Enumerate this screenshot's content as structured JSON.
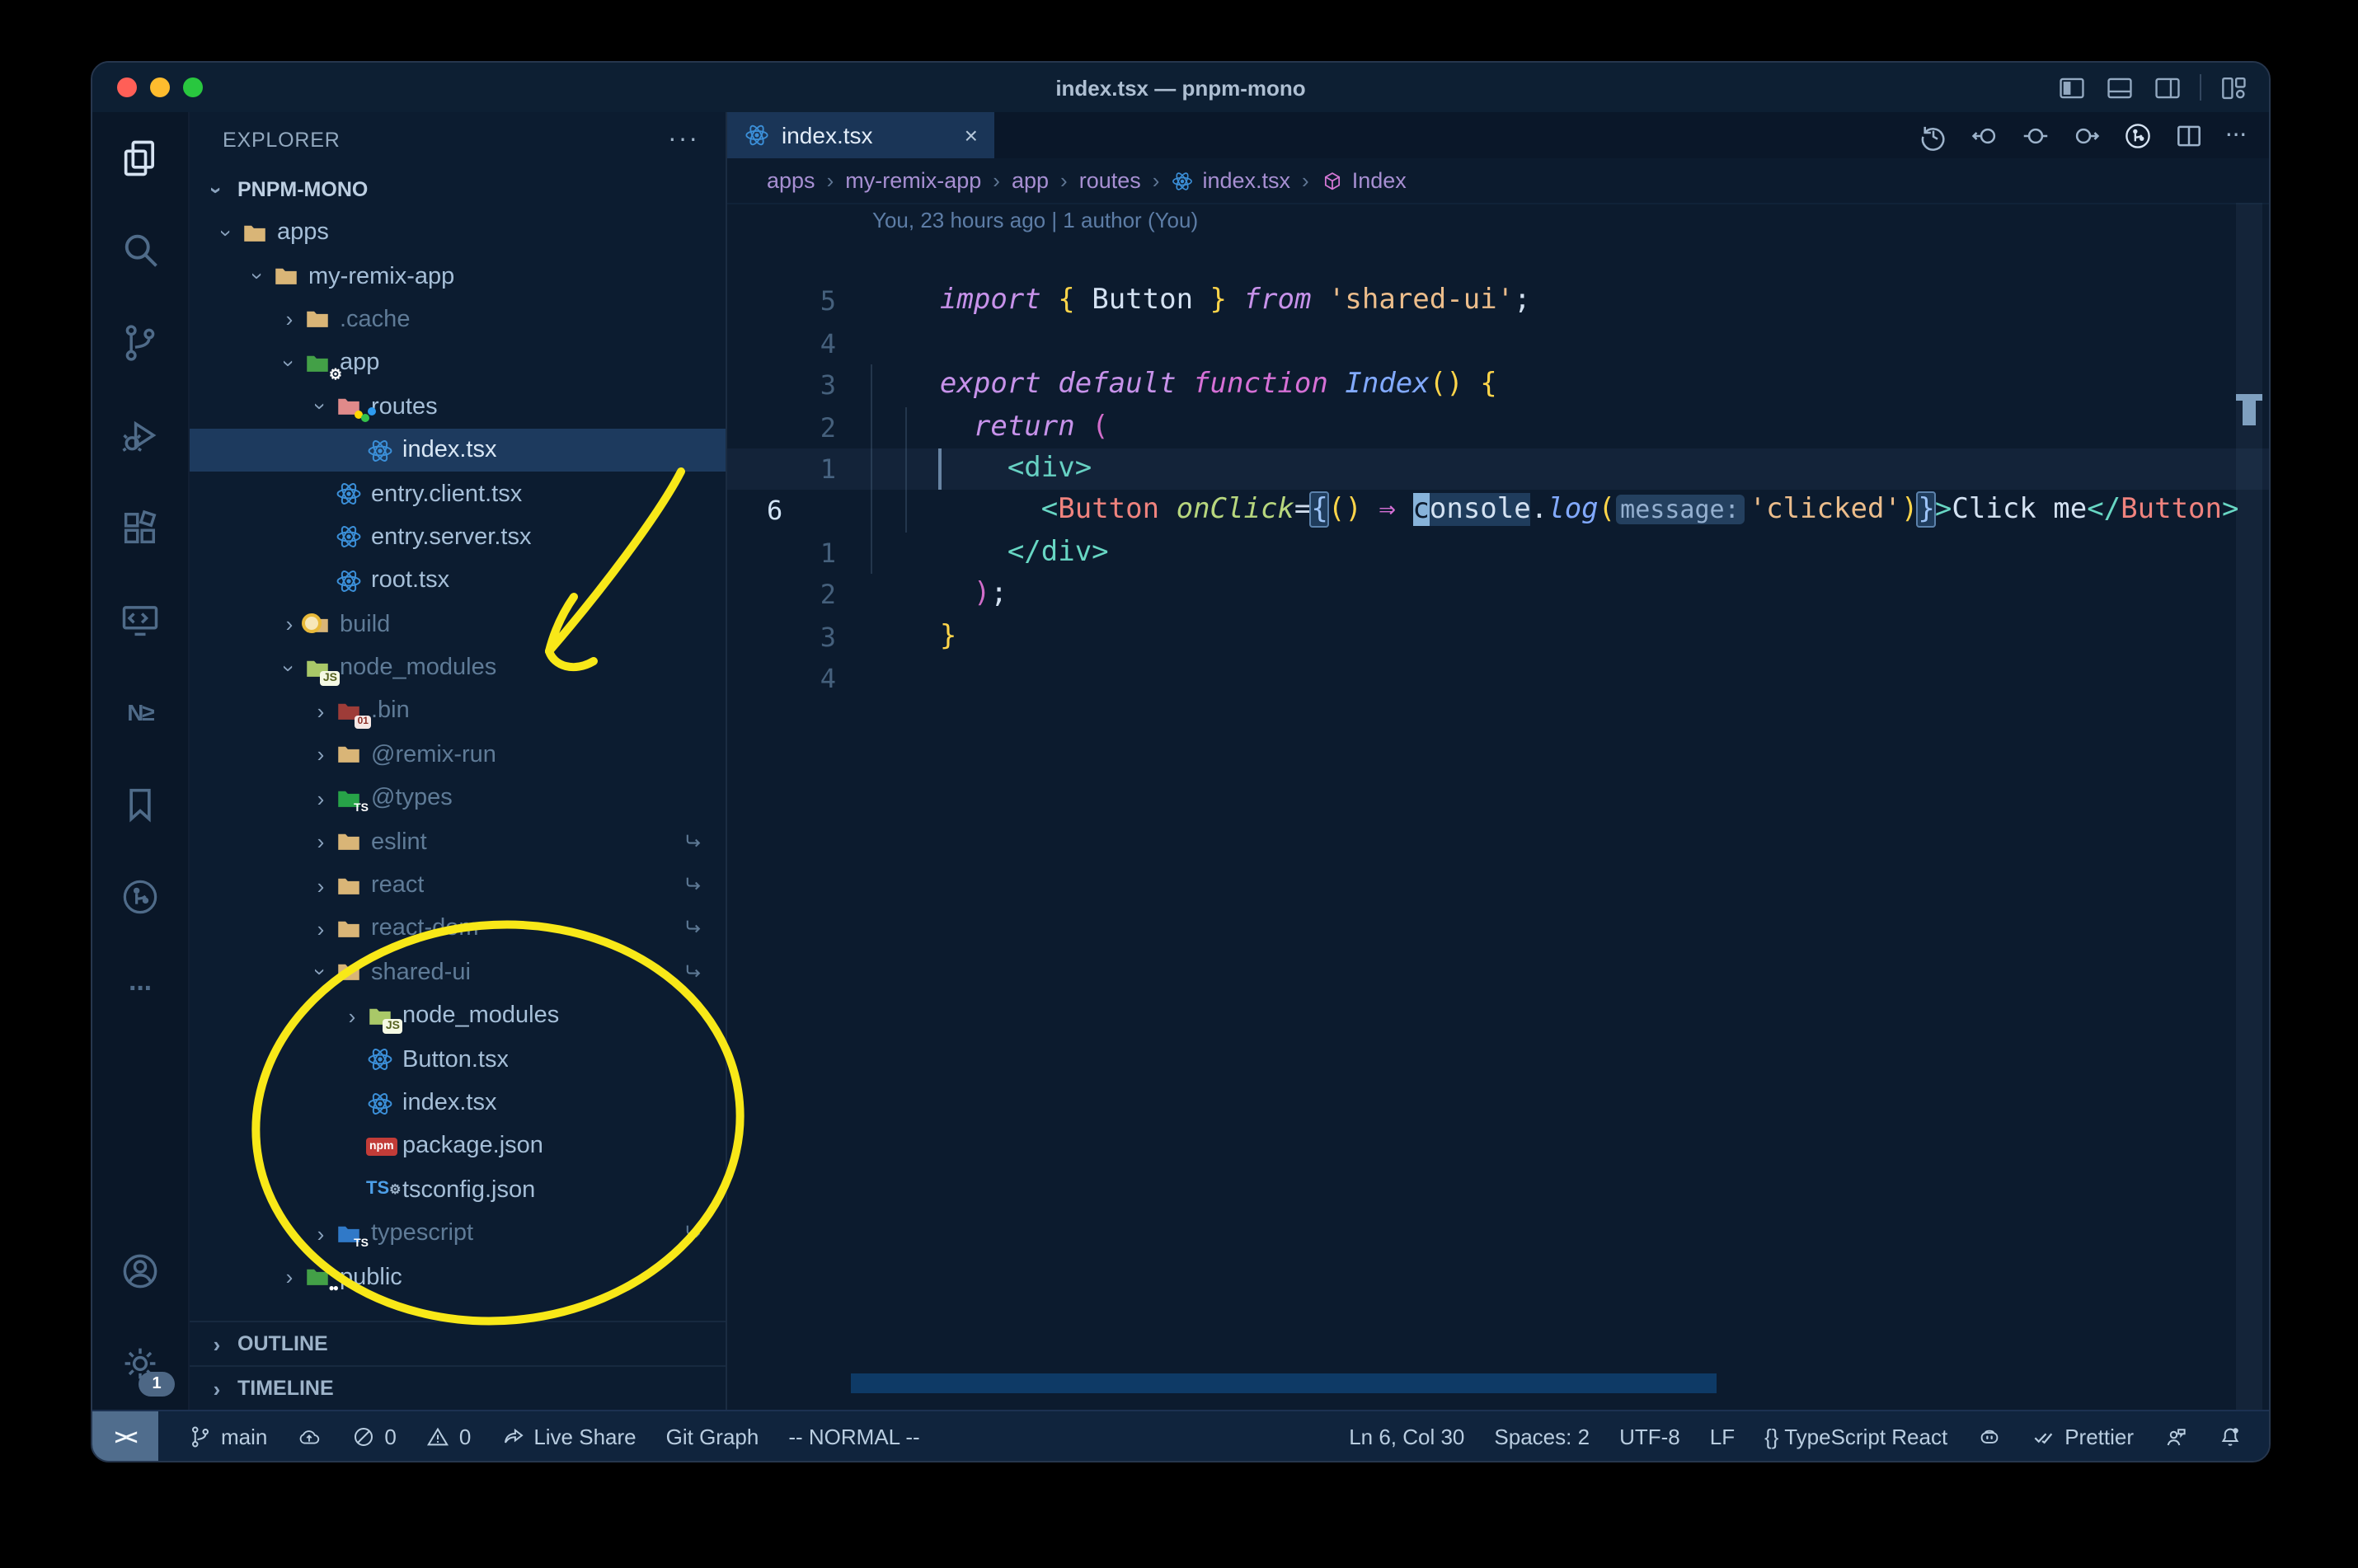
{
  "window": {
    "title": "index.tsx — pnpm-mono"
  },
  "titlebar": {
    "layout_icons": [
      "layoutL",
      "layoutP",
      "layoutR",
      "|",
      "layoutG"
    ]
  },
  "activity_bar": {
    "items": [
      {
        "name": "explorer",
        "icon": "files",
        "active": true
      },
      {
        "name": "search",
        "icon": "search"
      },
      {
        "name": "source-control",
        "icon": "branch"
      },
      {
        "name": "run-and-debug",
        "icon": "debug"
      },
      {
        "name": "extensions",
        "icon": "ext"
      },
      {
        "name": "remote-explorer",
        "icon": "remote-mon"
      },
      {
        "name": "nx-console",
        "icon": "nx",
        "text": "N≥"
      },
      {
        "name": "bookmarks",
        "icon": "bookmark"
      },
      {
        "name": "git-graph",
        "icon": "gitcircle"
      },
      {
        "name": "more-views",
        "icon": "dots",
        "text": "···"
      }
    ],
    "bottom": [
      {
        "name": "accounts",
        "icon": "account"
      },
      {
        "name": "settings",
        "icon": "gear",
        "badge": "1"
      }
    ]
  },
  "sidebar": {
    "header": "EXPLORER",
    "more": "···",
    "workspace": "PNPM-MONO",
    "tree": [
      {
        "label": "apps",
        "depth": 0,
        "icon": "folder",
        "chev": "open"
      },
      {
        "label": "my-remix-app",
        "depth": 1,
        "icon": "folder",
        "chev": "open"
      },
      {
        "label": ".cache",
        "depth": 2,
        "icon": "folder",
        "chev": "closed",
        "dim": true
      },
      {
        "label": "app",
        "depth": 2,
        "icon": "folder-app",
        "chev": "open"
      },
      {
        "label": "routes",
        "depth": 3,
        "icon": "folder-routes",
        "chev": "open"
      },
      {
        "label": "index.tsx",
        "depth": 4,
        "icon": "file-react",
        "selected": true
      },
      {
        "label": "entry.client.tsx",
        "depth": 3,
        "icon": "file-react"
      },
      {
        "label": "entry.server.tsx",
        "depth": 3,
        "icon": "file-react"
      },
      {
        "label": "root.tsx",
        "depth": 3,
        "icon": "file-react"
      },
      {
        "label": "build",
        "depth": 2,
        "icon": "folder-build",
        "chev": "closed",
        "dim": true
      },
      {
        "label": "node_modules",
        "depth": 2,
        "icon": "folder-node",
        "chev": "open",
        "dim": true
      },
      {
        "label": ".bin",
        "depth": 3,
        "icon": "folder-bin",
        "chev": "closed",
        "dim": true
      },
      {
        "label": "@remix-run",
        "depth": 3,
        "icon": "folder",
        "chev": "closed",
        "dim": true
      },
      {
        "label": "@types",
        "depth": 3,
        "icon": "folder-types",
        "chev": "closed",
        "dim": true
      },
      {
        "label": "eslint",
        "depth": 3,
        "icon": "folder",
        "chev": "closed",
        "dim": true,
        "symlink": true
      },
      {
        "label": "react",
        "depth": 3,
        "icon": "folder",
        "chev": "closed",
        "dim": true,
        "symlink": true
      },
      {
        "label": "react-dom",
        "depth": 3,
        "icon": "folder",
        "chev": "closed",
        "dim": true,
        "symlink": true
      },
      {
        "label": "shared-ui",
        "depth": 3,
        "icon": "folder",
        "chev": "open",
        "dim": true,
        "symlink": true
      },
      {
        "label": "node_modules",
        "depth": 4,
        "icon": "folder-node",
        "chev": "closed"
      },
      {
        "label": "Button.tsx",
        "depth": 4,
        "icon": "file-react"
      },
      {
        "label": "index.tsx",
        "depth": 4,
        "icon": "file-react"
      },
      {
        "label": "package.json",
        "depth": 4,
        "icon": "file-npm"
      },
      {
        "label": "tsconfig.json",
        "depth": 4,
        "icon": "file-tsconfig"
      },
      {
        "label": "typescript",
        "depth": 3,
        "icon": "folder-ts",
        "chev": "closed",
        "dim": true,
        "symlink": true
      },
      {
        "label": "public",
        "depth": 2,
        "icon": "folder-public",
        "chev": "closed"
      }
    ],
    "sections": [
      "OUTLINE",
      "TIMELINE"
    ]
  },
  "editor": {
    "tab": {
      "label": "index.tsx",
      "close": "×",
      "icon": "react"
    },
    "actions": [
      "history",
      "navback",
      "navdot",
      "navfwd",
      "gitcircle",
      "split",
      "dots"
    ],
    "breadcrumbs": [
      {
        "label": "apps"
      },
      {
        "label": "my-remix-app"
      },
      {
        "label": "app"
      },
      {
        "label": "routes"
      },
      {
        "label": "index.tsx",
        "icon": "atom"
      },
      {
        "label": "Index",
        "icon": "cube"
      }
    ],
    "codelens": "You, 23 hours ago | 1 author (You)",
    "lines": [
      {
        "num": "5",
        "tokens": [
          [
            "kw",
            "import"
          ],
          [
            "pl",
            " "
          ],
          [
            "bry",
            "{"
          ],
          [
            "pl",
            " Button "
          ],
          [
            "bry",
            "}"
          ],
          [
            "pl",
            " "
          ],
          [
            "kw",
            "from"
          ],
          [
            "pl",
            " "
          ],
          [
            "str",
            "'shared-ui'"
          ],
          [
            "pl",
            ";"
          ]
        ]
      },
      {
        "num": "4",
        "tokens": []
      },
      {
        "num": "3",
        "tokens": [
          [
            "kw",
            "export"
          ],
          [
            "pl",
            " "
          ],
          [
            "kw",
            "default"
          ],
          [
            "pl",
            " "
          ],
          [
            "fn",
            "function"
          ],
          [
            "pl",
            " "
          ],
          [
            "typ",
            "Index"
          ],
          [
            "bry",
            "()"
          ],
          [
            "pl",
            " "
          ],
          [
            "bry",
            "{"
          ]
        ]
      },
      {
        "num": "2",
        "tokens": [
          [
            "pl",
            "  "
          ],
          [
            "kw",
            "return"
          ],
          [
            "pl",
            " "
          ],
          [
            "brp",
            "("
          ]
        ]
      },
      {
        "num": "1",
        "tokens": [
          [
            "pl",
            "    "
          ],
          [
            "tag",
            "<div>"
          ]
        ]
      },
      {
        "num": "6",
        "current": true,
        "tokens": [
          [
            "pl",
            "      "
          ],
          [
            "tag",
            "<"
          ],
          [
            "comp",
            "Button"
          ],
          [
            "pl",
            " "
          ],
          [
            "attr",
            "onClick"
          ],
          [
            "op",
            "="
          ],
          [
            "brhl",
            "{"
          ],
          [
            "bry",
            "()"
          ],
          [
            "pl",
            " "
          ],
          [
            "arrow",
            "⇒"
          ],
          [
            "pl",
            " "
          ],
          [
            "cursor",
            "c"
          ],
          [
            "whl",
            "onsole"
          ],
          [
            "op",
            "."
          ],
          [
            "typ",
            "log"
          ],
          [
            "bry",
            "("
          ],
          [
            "inlay",
            "message:"
          ],
          [
            "str",
            "'clicked'"
          ],
          [
            "bry",
            ")"
          ],
          [
            "brhl",
            "}"
          ],
          [
            "tag",
            ">"
          ],
          [
            "pl",
            "Click me"
          ],
          [
            "tag",
            "</"
          ],
          [
            "comp",
            "Button"
          ],
          [
            "tag",
            ">"
          ]
        ]
      },
      {
        "num": "1",
        "tokens": [
          [
            "pl",
            "    "
          ],
          [
            "tag",
            "</div>"
          ]
        ]
      },
      {
        "num": "2",
        "tokens": [
          [
            "pl",
            "  "
          ],
          [
            "brp",
            ")"
          ],
          [
            "pl",
            ";"
          ]
        ]
      },
      {
        "num": "3",
        "tokens": [
          [
            "bry",
            "}"
          ]
        ]
      },
      {
        "num": "4",
        "tokens": []
      }
    ]
  },
  "statusbar": {
    "left": [
      {
        "icon": "remote",
        "label": "><",
        "block": true,
        "name": "remote-indicator"
      },
      {
        "icon": "branch",
        "label": "main",
        "name": "git-branch"
      },
      {
        "icon": "cloud",
        "label": "",
        "name": "sync-changes"
      },
      {
        "icon": "slash",
        "label": "0",
        "name": "errors"
      },
      {
        "icon": "warn",
        "label": "0",
        "name": "warnings"
      },
      {
        "icon": "share",
        "label": "Live Share",
        "name": "live-share"
      },
      {
        "label": "Git Graph",
        "name": "git-graph"
      },
      {
        "label": "-- NORMAL --",
        "name": "vim-mode"
      }
    ],
    "right": [
      {
        "label": "Ln 6, Col 30",
        "name": "cursor-position"
      },
      {
        "label": "Spaces: 2",
        "name": "indentation"
      },
      {
        "label": "UTF-8",
        "name": "encoding"
      },
      {
        "label": "LF",
        "name": "eol"
      },
      {
        "label": "{} TypeScript React",
        "name": "language-mode"
      },
      {
        "icon": "copilot",
        "label": "",
        "name": "copilot"
      },
      {
        "icon": "check2",
        "label": "Prettier",
        "name": "formatter"
      },
      {
        "icon": "feedback",
        "label": "",
        "name": "feedback"
      },
      {
        "icon": "bell",
        "label": "",
        "name": "notifications"
      }
    ]
  },
  "annotations": {
    "color": "#f8e818"
  }
}
